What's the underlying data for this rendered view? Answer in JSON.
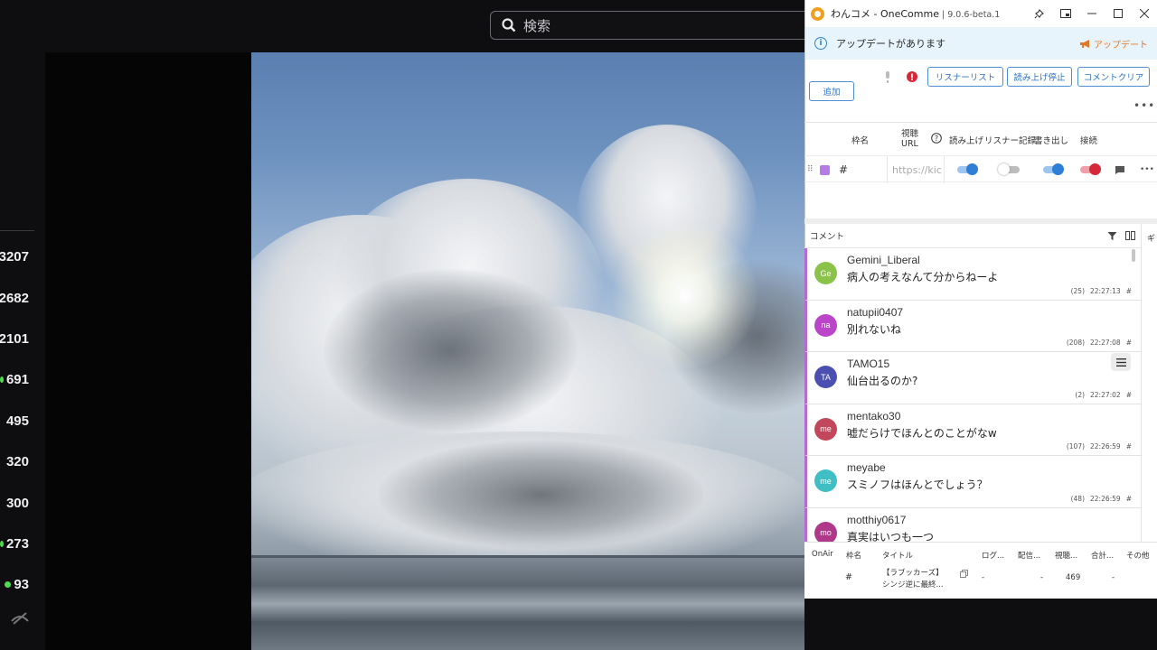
{
  "background": {
    "search_placeholder": "検索",
    "viewer_counts": [
      {
        "value": "3207",
        "live": false
      },
      {
        "value": "2682",
        "live": false
      },
      {
        "value": "2101",
        "live": false
      },
      {
        "value": "691",
        "live": true
      },
      {
        "value": "495",
        "live": false
      },
      {
        "value": "320",
        "live": false
      },
      {
        "value": "300",
        "live": false
      },
      {
        "value": "273",
        "live": true
      },
      {
        "value": "93",
        "live": true
      }
    ]
  },
  "app": {
    "title": "わんコメ - OneComme",
    "version": "9.0.6-beta.1",
    "banner": {
      "message": "アップデートがあります",
      "update_label": "アップデート"
    },
    "toolbar": {
      "add": "追加",
      "listener_list": "リスナーリスト",
      "read_stop": "読み上げ停止",
      "comment_clear": "コメントクリア"
    },
    "config_headers": {
      "frame_name": "枠名",
      "view": "視聴",
      "url": "URL",
      "read": "読み上げ",
      "listener_record": "リスナー記録",
      "export": "書き出し",
      "connect": "接続"
    },
    "config_row": {
      "frame": "#",
      "url_placeholder": "https://kic"
    },
    "comments_title": "コメント",
    "side_tab": "ギ",
    "comments": [
      {
        "initials": "Ge",
        "color": "#8bc34a",
        "name": "Gemini_Liberal",
        "text": "病人の考えなんて分からねーよ",
        "count": "(25)",
        "time": "22:27:13",
        "frame": "#",
        "has_menu": false
      },
      {
        "initials": "na",
        "color": "#ba45c9",
        "name": "natupii0407",
        "text": "別れないね",
        "count": "(208)",
        "time": "22:27:08",
        "frame": "#",
        "has_menu": false
      },
      {
        "initials": "TA",
        "color": "#4b4fb0",
        "name": "TAMO15",
        "text": "仙台出るのか?",
        "count": "(2)",
        "time": "22:27:02",
        "frame": "#",
        "has_menu": true
      },
      {
        "initials": "me",
        "color": "#c2475b",
        "name": "mentako30",
        "text": "嘘だらけでほんとのことがなw",
        "count": "(107)",
        "time": "22:26:59",
        "frame": "#",
        "has_menu": false
      },
      {
        "initials": "me",
        "color": "#3fbfc4",
        "name": "meyabe",
        "text": "スミノフはほんとでしょう？",
        "count": "(48)",
        "time": "22:26:59",
        "frame": "#",
        "has_menu": false
      },
      {
        "initials": "mo",
        "color": "#b0388a",
        "name": "motthiy0617",
        "text": "真実はいつも一つ",
        "count": "",
        "time": "",
        "frame": "",
        "has_menu": false
      }
    ],
    "bottom_headers": {
      "onair": "OnAir",
      "frame": "枠名",
      "title": "タイトル",
      "log": "ログ...",
      "stream": "配信...",
      "viewers": "視聴...",
      "total": "合計...",
      "other": "その他"
    },
    "bottom_row": {
      "frame": "#",
      "title_line1": "【ラブッカーズ】",
      "title_line2": "シンジ逆に最終...",
      "log": "-",
      "stream": "-",
      "viewers": "469",
      "total": "-"
    }
  }
}
